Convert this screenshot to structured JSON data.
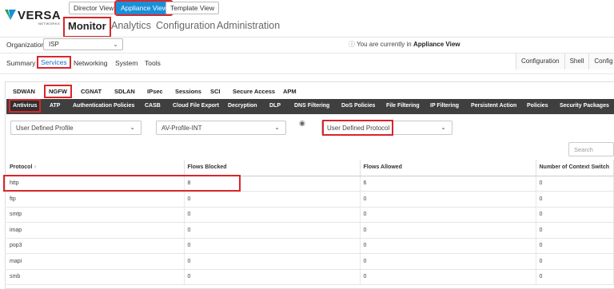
{
  "brand": {
    "name": "VERSA",
    "sub": "NETWORKS"
  },
  "view_switch": [
    "Director View",
    "Appliance View",
    "Template View"
  ],
  "main_nav": [
    "Monitor",
    "Analytics",
    "Configuration",
    "Administration"
  ],
  "org": {
    "label": "Organization",
    "value": "ISP"
  },
  "appliance_note": {
    "prefix": "You are currently in",
    "value": "Appliance View"
  },
  "sub_tabs": [
    "Summary",
    "Services",
    "Networking",
    "System",
    "Tools"
  ],
  "right_tabs": [
    "Configuration",
    "Shell",
    "Config S"
  ],
  "service_tabs": [
    "SDWAN",
    "NGFW",
    "CGNAT",
    "SDLAN",
    "IPsec",
    "Sessions",
    "SCI",
    "Secure Access",
    "APM"
  ],
  "ngfw_tabs": [
    "Antivirus",
    "ATP",
    "Authentication Policies",
    "CASB",
    "Cloud File Export",
    "Decryption",
    "DLP",
    "DNS Filtering",
    "DoS Policies",
    "File Filtering",
    "IP Filtering",
    "Persistent Action",
    "Policies",
    "Security Packages"
  ],
  "filters": {
    "profile_type": "User Defined Profile",
    "profile": "AV-Profile-INT",
    "protocol_type": "User Defined Protocol"
  },
  "search": {
    "placeholder": "Search"
  },
  "table": {
    "columns": [
      "Protocol",
      "Flows Blocked",
      "Flows Allowed",
      "Number of Context Switch"
    ],
    "rows": [
      [
        "http",
        "8",
        "6",
        "0"
      ],
      [
        "ftp",
        "0",
        "0",
        "0"
      ],
      [
        "smtp",
        "0",
        "0",
        "0"
      ],
      [
        "imap",
        "0",
        "0",
        "0"
      ],
      [
        "pop3",
        "0",
        "0",
        "0"
      ],
      [
        "mapi",
        "0",
        "0",
        "0"
      ],
      [
        "smb",
        "0",
        "0",
        "0"
      ]
    ]
  },
  "colors": {
    "accent": "#1a8fd8",
    "highlight": "#d9262a",
    "dark_bar": "#3f3f3f",
    "logo_green": "#1fa15a",
    "logo_blue": "#1a8fd8"
  }
}
